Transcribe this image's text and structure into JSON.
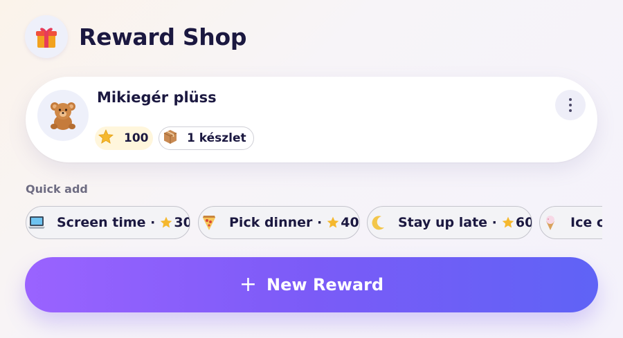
{
  "header": {
    "title": "Reward Shop",
    "icon": "gift-icon"
  },
  "reward_card": {
    "name": "Mikiegér plüss",
    "icon": "teddy-bear-icon",
    "points": "100",
    "stock": "1 készlet",
    "menu_icon": "more-vertical-icon"
  },
  "quick_add": {
    "label": "Quick add",
    "chips": [
      {
        "icon": "laptop-icon",
        "label": "Screen time ·",
        "cost": "30"
      },
      {
        "icon": "pizza-icon",
        "label": "Pick dinner ·",
        "cost": "40"
      },
      {
        "icon": "moon-icon",
        "label": "Stay up late ·",
        "cost": "60"
      },
      {
        "icon": "ice-cream-icon",
        "label": "Ice cr",
        "cost": ""
      }
    ]
  },
  "new_button": {
    "label": "New Reward"
  },
  "colors": {
    "accent_start": "#9a63ff",
    "accent_end": "#5f63f6",
    "star": "#f5b82e"
  }
}
